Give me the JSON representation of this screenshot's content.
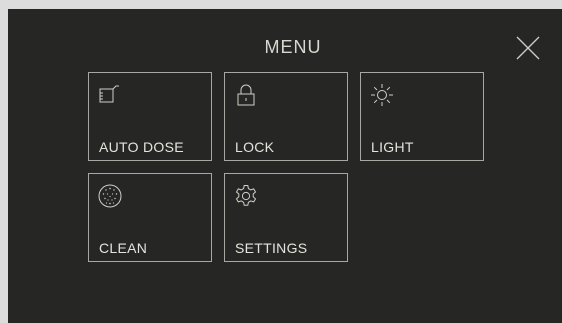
{
  "menu": {
    "title": "MENU",
    "close_icon": "close-icon",
    "tiles": [
      {
        "label": "AUTO DOSE",
        "icon": "measuring-cup-icon"
      },
      {
        "label": "LOCK",
        "icon": "padlock-icon"
      },
      {
        "label": "LIGHT",
        "icon": "sun-icon"
      },
      {
        "label": "CLEAN",
        "icon": "sparkle-circle-icon"
      },
      {
        "label": "SETTINGS",
        "icon": "gear-icon"
      }
    ]
  },
  "colors": {
    "background": "#262624",
    "text": "#e4e4de",
    "tile_border": "#a8a8a2",
    "frame": "#dcdcdc"
  }
}
